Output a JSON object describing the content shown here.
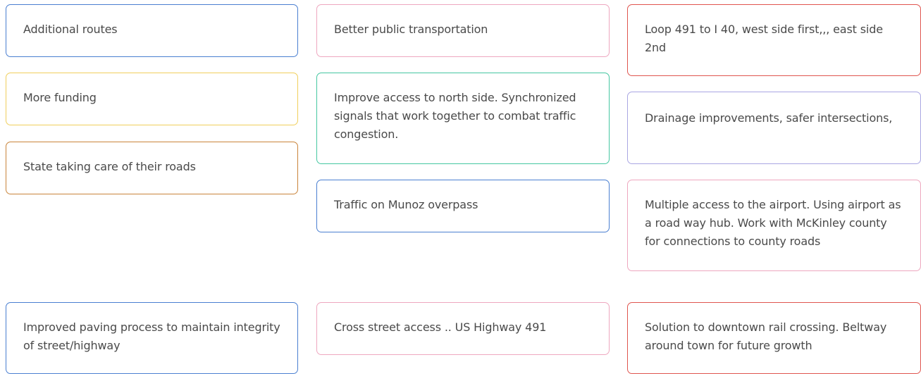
{
  "cards": [
    {
      "text": "Additional routes",
      "border_color": "#4a7fd1"
    },
    {
      "text": "More funding",
      "border_color": "#f0cf5c"
    },
    {
      "text": "State taking care of their roads",
      "border_color": "#c9843a"
    },
    {
      "text": "Improved paving process to maintain integrity of street/highway",
      "border_color": "#4a7fd1"
    },
    {
      "text": "Better public transportation",
      "border_color": "#eea7bf"
    },
    {
      "text": "Improve access to north side. Synchronized signals that work together to combat traffic congestion.",
      "border_color": "#45c7a1"
    },
    {
      "text": "Traffic on Munoz overpass",
      "border_color": "#4a7fd1"
    },
    {
      "text": "Cross street access .. US Highway 491",
      "border_color": "#eea7bf"
    },
    {
      "text": "Loop 491 to I 40, west side first,,, east side 2nd",
      "border_color": "#e0554f"
    },
    {
      "text": "Drainage improvements, safer intersections,",
      "border_color": "#a9a6e3"
    },
    {
      "text": "Multiple access to the airport. Using airport as a road way hub. Work with McKinley county for connections to county roads",
      "border_color": "#eea7bf"
    },
    {
      "text": "Solution to downtown rail crossing. Beltway around town for future growth",
      "border_color": "#e0554f"
    }
  ]
}
